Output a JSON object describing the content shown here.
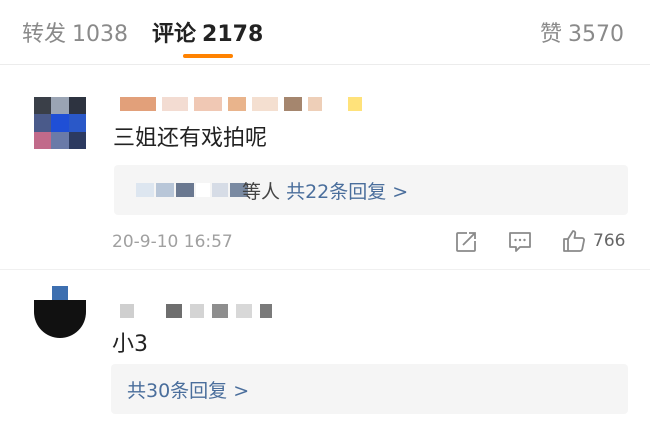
{
  "tabs": {
    "forward": {
      "label": "转发",
      "count": "1038"
    },
    "comments": {
      "label": "评论",
      "count": "2178"
    },
    "likes": {
      "label": "赞",
      "count": "3570"
    }
  },
  "colors": {
    "accent": "#ff8200",
    "link": "#4a6e9c"
  },
  "comments": [
    {
      "text": "三姐还有戏拍呢",
      "reply_prefix": "等人",
      "reply_link": "共22条回复 >",
      "timestamp": "20-9-10 16:57",
      "like_count": "766"
    },
    {
      "text": "小3",
      "reply_link": "共30条回复 >"
    }
  ]
}
